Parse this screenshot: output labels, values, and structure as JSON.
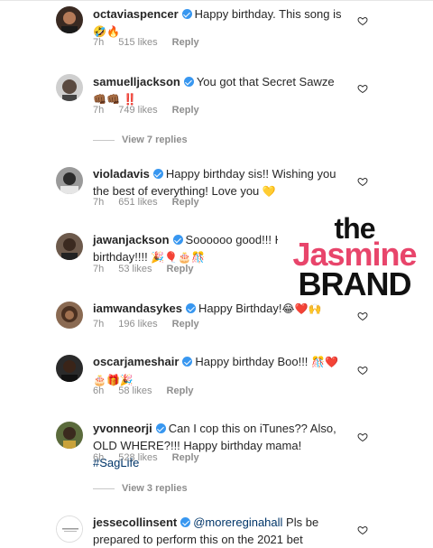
{
  "comments": [
    {
      "username": "octaviaspencer",
      "text": "Happy birthday. This song is",
      "emoji": "🤣🔥",
      "time": "7h",
      "likes": "515 likes",
      "reply": "Reply"
    },
    {
      "username": "samuelljackson",
      "text": "You got that Secret Sawze",
      "emoji": "👊🏾👊🏾 ‼️",
      "time": "7h",
      "likes": "749 likes",
      "reply": "Reply"
    },
    {
      "username": "violadavis",
      "text": "Happy birthday sis!! Wishing you the best of everything! Love you",
      "emoji": "💛",
      "time": "7h",
      "likes": "651 likes",
      "reply": "Reply"
    },
    {
      "username": "jawanjackson",
      "text": "Soooooo good!!! Happy birthday!!!!",
      "emoji": "🎉🎈🎂🎊",
      "time": "7h",
      "likes": "53 likes",
      "reply": "Reply"
    },
    {
      "username": "iamwandasykes",
      "text": "Happy Birthday!",
      "emoji": "😂❤️🙌",
      "time": "7h",
      "likes": "196 likes",
      "reply": "Reply"
    },
    {
      "username": "oscarjameshair",
      "text": "Happy birthday Boo!!!",
      "emoji": "🎊❤️🎂🎁🎉",
      "time": "6h",
      "likes": "58 likes",
      "reply": "Reply"
    },
    {
      "username": "yvonneorji",
      "text": "Can I cop this on iTunes?? Also, OLD WHERE?!!! Happy birthday mama!",
      "hashtag": "#SagLife",
      "time": "6h",
      "likes": "528 likes",
      "reply": "Reply"
    },
    {
      "username": "jessecollinsent",
      "mention": "@morereginahall",
      "text": "Pls be prepared to perform this on the 2021 bet"
    }
  ],
  "view_replies": [
    "View 7 replies",
    "View 3 replies"
  ],
  "watermark": {
    "the": "the",
    "jasmine": "Jasmine",
    "brand": "BRAND"
  },
  "colors": {
    "accent_blue": "#3897f0",
    "meta_gray": "#8e8e8e",
    "watermark_pink": "#e8456b"
  }
}
